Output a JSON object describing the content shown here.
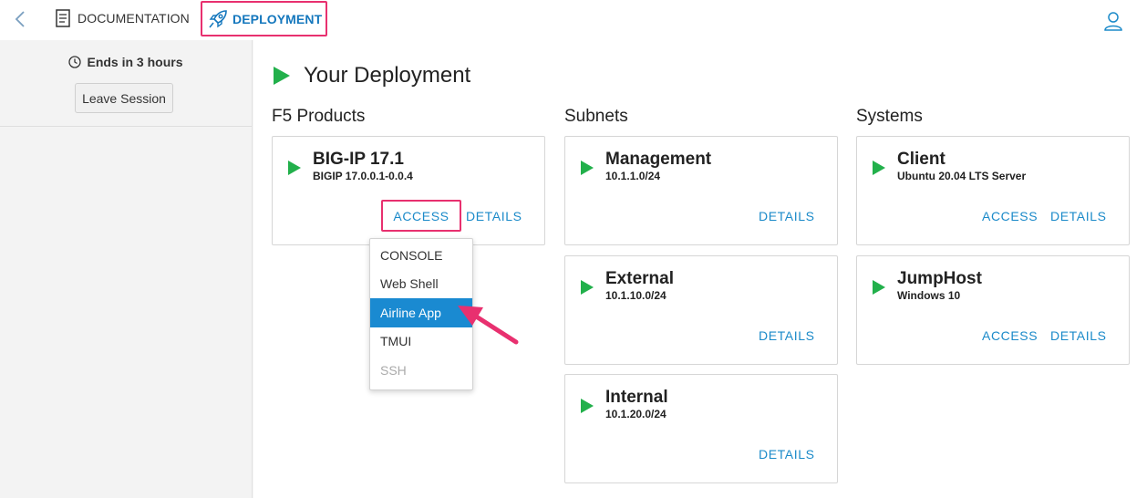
{
  "topbar": {
    "docs_label": "DOCUMENTATION",
    "deploy_label": "DEPLOYMENT"
  },
  "sidebar": {
    "timer": "Ends in 3 hours",
    "leave_label": "Leave Session"
  },
  "main": {
    "title": "Your Deployment",
    "columns": {
      "products": "F5 Products",
      "subnets": "Subnets",
      "systems": "Systems"
    },
    "products": [
      {
        "name": "BIG-IP 17.1",
        "sub": "BIGIP 17.0.0.1-0.0.4",
        "access": "ACCESS",
        "details": "DETAILS"
      }
    ],
    "subnets": [
      {
        "name": "Management",
        "sub": "10.1.1.0/24",
        "details": "DETAILS"
      },
      {
        "name": "External",
        "sub": "10.1.10.0/24",
        "details": "DETAILS"
      },
      {
        "name": "Internal",
        "sub": "10.1.20.0/24",
        "details": "DETAILS"
      }
    ],
    "systems": [
      {
        "name": "Client",
        "sub": "Ubuntu 20.04 LTS Server",
        "access": "ACCESS",
        "details": "DETAILS"
      },
      {
        "name": "JumpHost",
        "sub": "Windows 10",
        "access": "ACCESS",
        "details": "DETAILS"
      }
    ]
  },
  "dropdown": {
    "items": [
      "CONSOLE",
      "Web Shell",
      "Airline App",
      "TMUI",
      "SSH"
    ],
    "selected": "Airline App",
    "disabled": "SSH"
  },
  "colors": {
    "accent": "#1b8ac9",
    "highlight": "#e8306f",
    "play": "#22b04b",
    "menu_active": "#1a8ad1"
  },
  "icons": [
    "chevron-left-icon",
    "document-icon",
    "rocket-icon",
    "user-icon",
    "clock-icon",
    "play-icon",
    "arrow-pointer-icon"
  ]
}
